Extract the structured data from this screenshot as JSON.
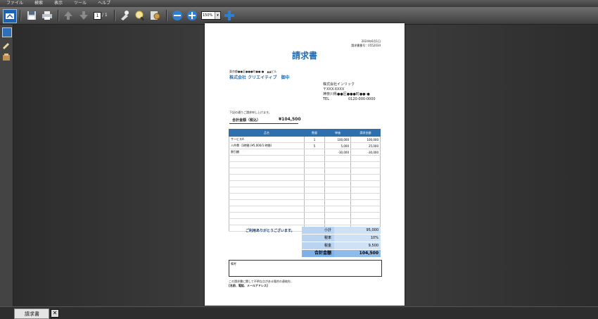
{
  "menu": [
    "ファイル",
    "検索",
    "表示",
    "ツール",
    "ヘルプ"
  ],
  "toolbar": {
    "page_value": "1",
    "page_total": "/ 1",
    "zoom_value": "150%"
  },
  "tab": {
    "label": "請求書",
    "close": "✕"
  },
  "invoice": {
    "date": "2024年6月1日",
    "invoice_no": "請求書番号：0552034",
    "title": "請求書",
    "to_address": "東京都●●区●●●町●●-●　▲▲ビル",
    "to_name": "株式会社 クリエイティブ　御中",
    "from_company": "株式会社インリック",
    "from_zip": "〒XXX-XXXX",
    "from_address": "神奈川県●●区●●●町●●-●",
    "from_tel_label": "TEL",
    "from_tel": "0120-000-0000",
    "intro": "下記の通りご請求申し上げます。",
    "total_label": "合計金額（税込）",
    "total_value": "¥104,500",
    "headers": [
      "品名",
      "数量",
      "単価",
      "請求金額"
    ],
    "rows": [
      [
        "サービスA",
        "1",
        "100,000",
        "100,000"
      ],
      [
        "人件費（1時間 (¥5,000/1 時間)",
        "5",
        "5,000",
        "25,000"
      ],
      [
        "割引額",
        "",
        "-30,000",
        "-30,000"
      ],
      [
        "",
        "",
        "",
        ""
      ],
      [
        "",
        "",
        "",
        ""
      ],
      [
        "",
        "",
        "",
        ""
      ],
      [
        "",
        "",
        "",
        ""
      ],
      [
        "",
        "",
        "",
        ""
      ],
      [
        "",
        "",
        "",
        ""
      ],
      [
        "",
        "",
        "",
        ""
      ],
      [
        "",
        "",
        "",
        ""
      ],
      [
        "",
        "",
        "",
        ""
      ],
      [
        "",
        "",
        "",
        ""
      ],
      [
        "",
        "",
        "",
        ""
      ],
      [
        "",
        "",
        "",
        ""
      ]
    ],
    "thanks": "ご利用ありがとうございます。",
    "subtotal_label": "小計",
    "subtotal": "95,000",
    "tax_rate_label": "税率",
    "tax_rate": "10%",
    "tax_label": "税金",
    "tax": "9,500",
    "grand_label": "合計金額",
    "grand": "104,500",
    "notes_label": "備考",
    "footer1": "この請求書に関して不明な点がある場合の連絡先:",
    "footer2": "[名前、電話、メールアドレス]"
  },
  "colors": {
    "accent": "#2e6fad",
    "title": "#1f6fb8"
  }
}
